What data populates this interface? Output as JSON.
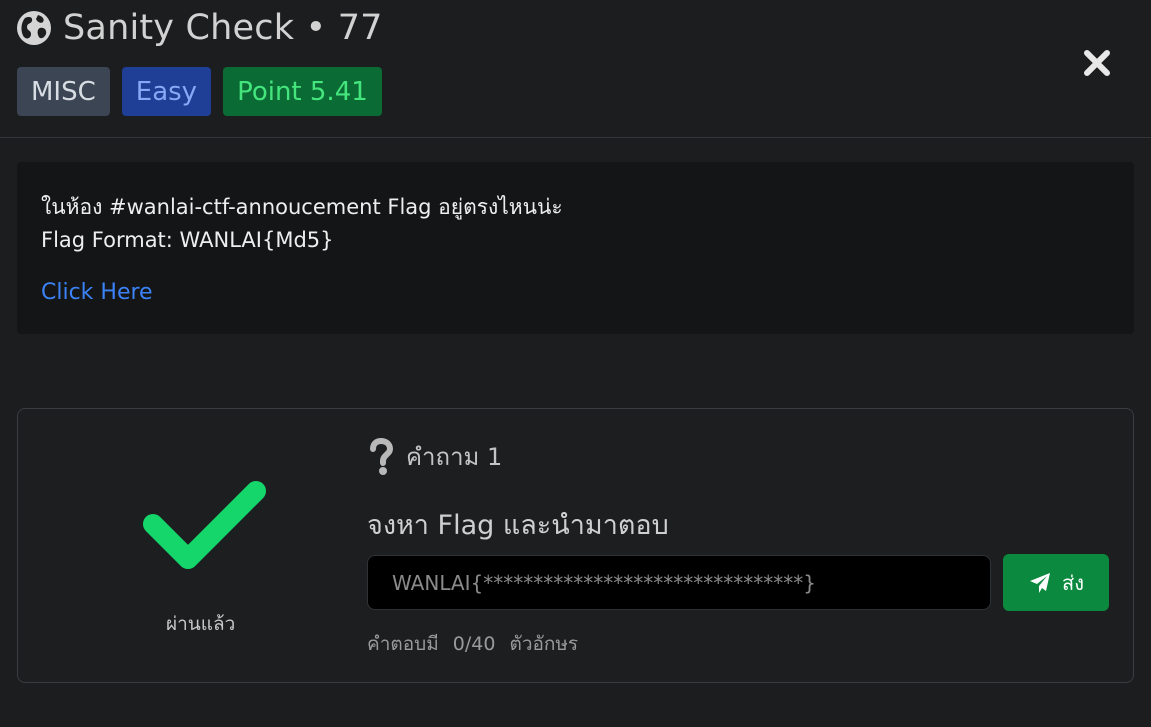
{
  "challenge": {
    "title": "Sanity Check • 77",
    "category": "MISC",
    "difficulty": "Easy",
    "points": "Point 5.41"
  },
  "description": {
    "line1": "ในห้อง #wanlai-ctf-annoucement Flag อยู่ตรงไหนน่ะ",
    "line2": "Flag Format: WANLAI{Md5}",
    "link_text": "Click Here"
  },
  "question": {
    "number_label": "คำถาม 1",
    "text": "จงหา Flag และนำมาตอบ",
    "status": "ผ่านแล้ว",
    "answer_value": "WANLAI{********************************}",
    "submit_label": "ส่ง",
    "count_prefix": "คำตอบมี",
    "count_value": "0/40",
    "count_suffix": "ตัวอักษร"
  },
  "colors": {
    "background": "#1c1d1e",
    "success": "#14d66b",
    "link": "#3b82f6",
    "submit": "#0b8a3f"
  },
  "icons": [
    "globe-icon",
    "close-icon",
    "checkmark-icon",
    "question-icon",
    "send-icon"
  ]
}
